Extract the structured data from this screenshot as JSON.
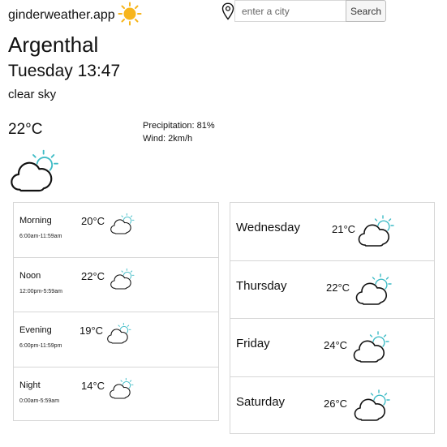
{
  "header": {
    "brand": "ginderweather.app",
    "sun_icon": "sun-icon",
    "pin_icon": "location-pin-icon",
    "search_placeholder": "enter a city",
    "search_label": "Search"
  },
  "current": {
    "city": "Argenthal",
    "datetime": "Tuesday 13:47",
    "description": "clear sky",
    "temperature": "22°C",
    "precipitation": "Precipitation: 81%",
    "wind": "Wind: 2km/h",
    "icon": "partly-cloudy-icon"
  },
  "times_of_day": [
    {
      "name": "Morning",
      "range": "6:00am-11:59am",
      "temp": "20°C"
    },
    {
      "name": "Noon",
      "range": "12:00pm-5:59am",
      "temp": "22°C"
    },
    {
      "name": "Evening",
      "range": "6:00pm-11:59pm",
      "temp": "19°C"
    },
    {
      "name": "Night",
      "range": "0:00am-5:59am",
      "temp": "14°C"
    }
  ],
  "forecast": [
    {
      "day": "Wednesday",
      "temp": "21°C"
    },
    {
      "day": "Thursday",
      "temp": "22°C"
    },
    {
      "day": "Friday",
      "temp": "24°C"
    },
    {
      "day": "Saturday",
      "temp": "26°C"
    }
  ],
  "colors": {
    "sun": "#f7b51c",
    "sun_accent": "#3fbcc6",
    "cloud_stroke": "#111111"
  }
}
